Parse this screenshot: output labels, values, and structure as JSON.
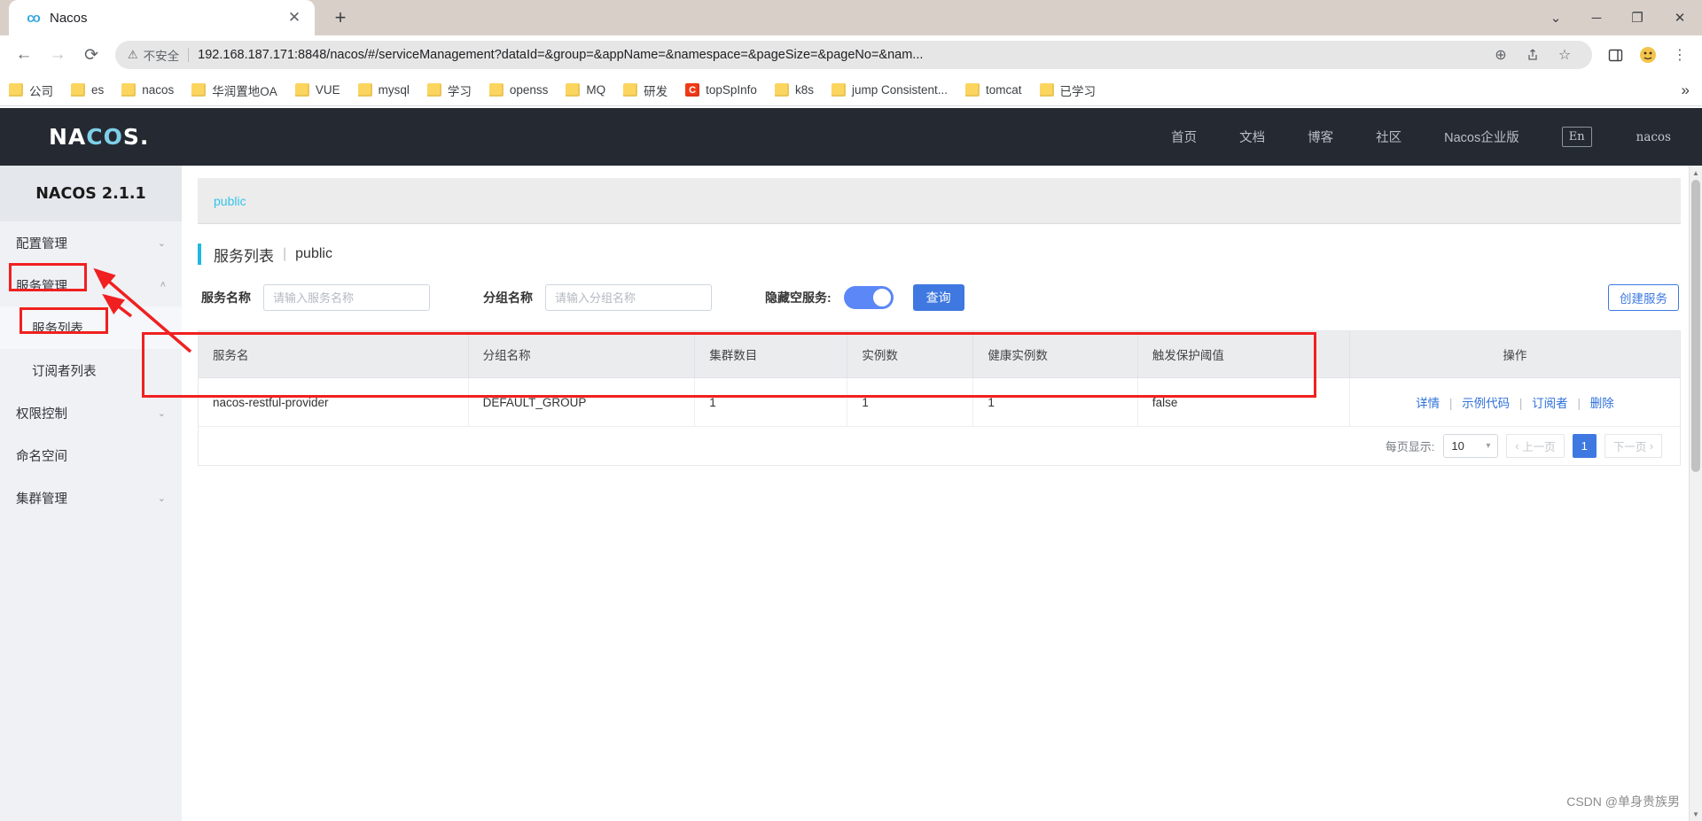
{
  "browser": {
    "tab": {
      "title": "Nacos",
      "favicon": "nacos-logo-icon",
      "close": "✕"
    },
    "new_tab": "+",
    "window_controls": {
      "minimize_caret": "⌄",
      "minimize": "─",
      "maximize": "❐",
      "close": "✕"
    },
    "nav": {
      "back": "←",
      "forward": "→",
      "reload": "⟳"
    },
    "omnibox": {
      "warning_icon": "⚠",
      "warning_text": "不安全",
      "url": "192.168.187.171:8848/nacos/#/serviceManagement?dataId=&group=&appName=&namespace=&pageSize=&pageNo=&nam...",
      "zoom_icon": "⊕",
      "share_icon": "share-icon",
      "bookmark_icon": "☆",
      "sidepanel_icon": "sidepanel-icon",
      "extension_icon": "extension-icon",
      "menu_icon": "⋮"
    },
    "bookmarks": [
      {
        "label": "公司",
        "type": "folder"
      },
      {
        "label": "es",
        "type": "folder"
      },
      {
        "label": "nacos",
        "type": "folder"
      },
      {
        "label": "华润置地OA",
        "type": "folder"
      },
      {
        "label": "VUE",
        "type": "folder"
      },
      {
        "label": "mysql",
        "type": "folder"
      },
      {
        "label": "学习",
        "type": "folder"
      },
      {
        "label": "openss",
        "type": "folder"
      },
      {
        "label": "MQ",
        "type": "folder"
      },
      {
        "label": "研发",
        "type": "folder"
      },
      {
        "label": "topSpInfo",
        "type": "letter",
        "letter": "C"
      },
      {
        "label": "k8s",
        "type": "folder"
      },
      {
        "label": "jump Consistent...",
        "type": "folder"
      },
      {
        "label": "tomcat",
        "type": "folder"
      },
      {
        "label": "已学习",
        "type": "folder"
      }
    ],
    "bookmarks_overflow": "»"
  },
  "app": {
    "logo": {
      "pre": "NA",
      "mid": "CO",
      "post": "S."
    },
    "nav": [
      {
        "label": "首页"
      },
      {
        "label": "文档"
      },
      {
        "label": "博客"
      },
      {
        "label": "社区"
      },
      {
        "label": "Nacos企业版"
      }
    ],
    "lang_toggle": "En",
    "user": "nacos",
    "sidebar": {
      "title": "NACOS 2.1.1",
      "items": [
        {
          "label": "配置管理",
          "chevron": "⌄",
          "sub": false,
          "active": false
        },
        {
          "label": "服务管理",
          "chevron": "˄",
          "sub": false,
          "active": false
        },
        {
          "label": "服务列表",
          "chevron": "",
          "sub": true,
          "active": true
        },
        {
          "label": "订阅者列表",
          "chevron": "",
          "sub": true,
          "active": false
        },
        {
          "label": "权限控制",
          "chevron": "⌄",
          "sub": false,
          "active": false
        },
        {
          "label": "命名空间",
          "chevron": "",
          "sub": false,
          "active": false
        },
        {
          "label": "集群管理",
          "chevron": "⌄",
          "sub": false,
          "active": false
        }
      ]
    },
    "namespace_tab": "public",
    "page_title": {
      "main": "服务列表",
      "divider": "|",
      "sub": "public"
    },
    "filters": {
      "service_name_label": "服务名称",
      "service_name_placeholder": "请输入服务名称",
      "service_name_value": "",
      "group_name_label": "分组名称",
      "group_name_placeholder": "请输入分组名称",
      "group_name_value": "",
      "hide_empty_label": "隐藏空服务:",
      "hide_empty_on": true,
      "query_button": "查询",
      "create_button": "创建服务"
    },
    "table": {
      "headers": [
        "服务名",
        "分组名称",
        "集群数目",
        "实例数",
        "健康实例数",
        "触发保护阈值",
        "操作"
      ],
      "rows": [
        {
          "service_name": "nacos-restful-provider",
          "group_name": "DEFAULT_GROUP",
          "cluster_count": "1",
          "instance_count": "1",
          "healthy_count": "1",
          "protect_threshold": "false",
          "actions": [
            "详情",
            "示例代码",
            "订阅者",
            "删除"
          ],
          "action_sep": "|"
        }
      ]
    },
    "pagination": {
      "per_page_label": "每页显示:",
      "per_page_value": "10",
      "prev": "上一页",
      "prev_icon": "‹",
      "pages": [
        "1"
      ],
      "current_page": "1",
      "next": "下一页",
      "next_icon": "›"
    },
    "watermark": "CSDN @单身贵族男"
  },
  "colors": {
    "accent_blue": "#3e78e0",
    "nacos_cyan": "#1fb8e0",
    "header_dark": "#252a32",
    "annotation_red": "#f02020",
    "link_blue": "#2e71d8"
  }
}
